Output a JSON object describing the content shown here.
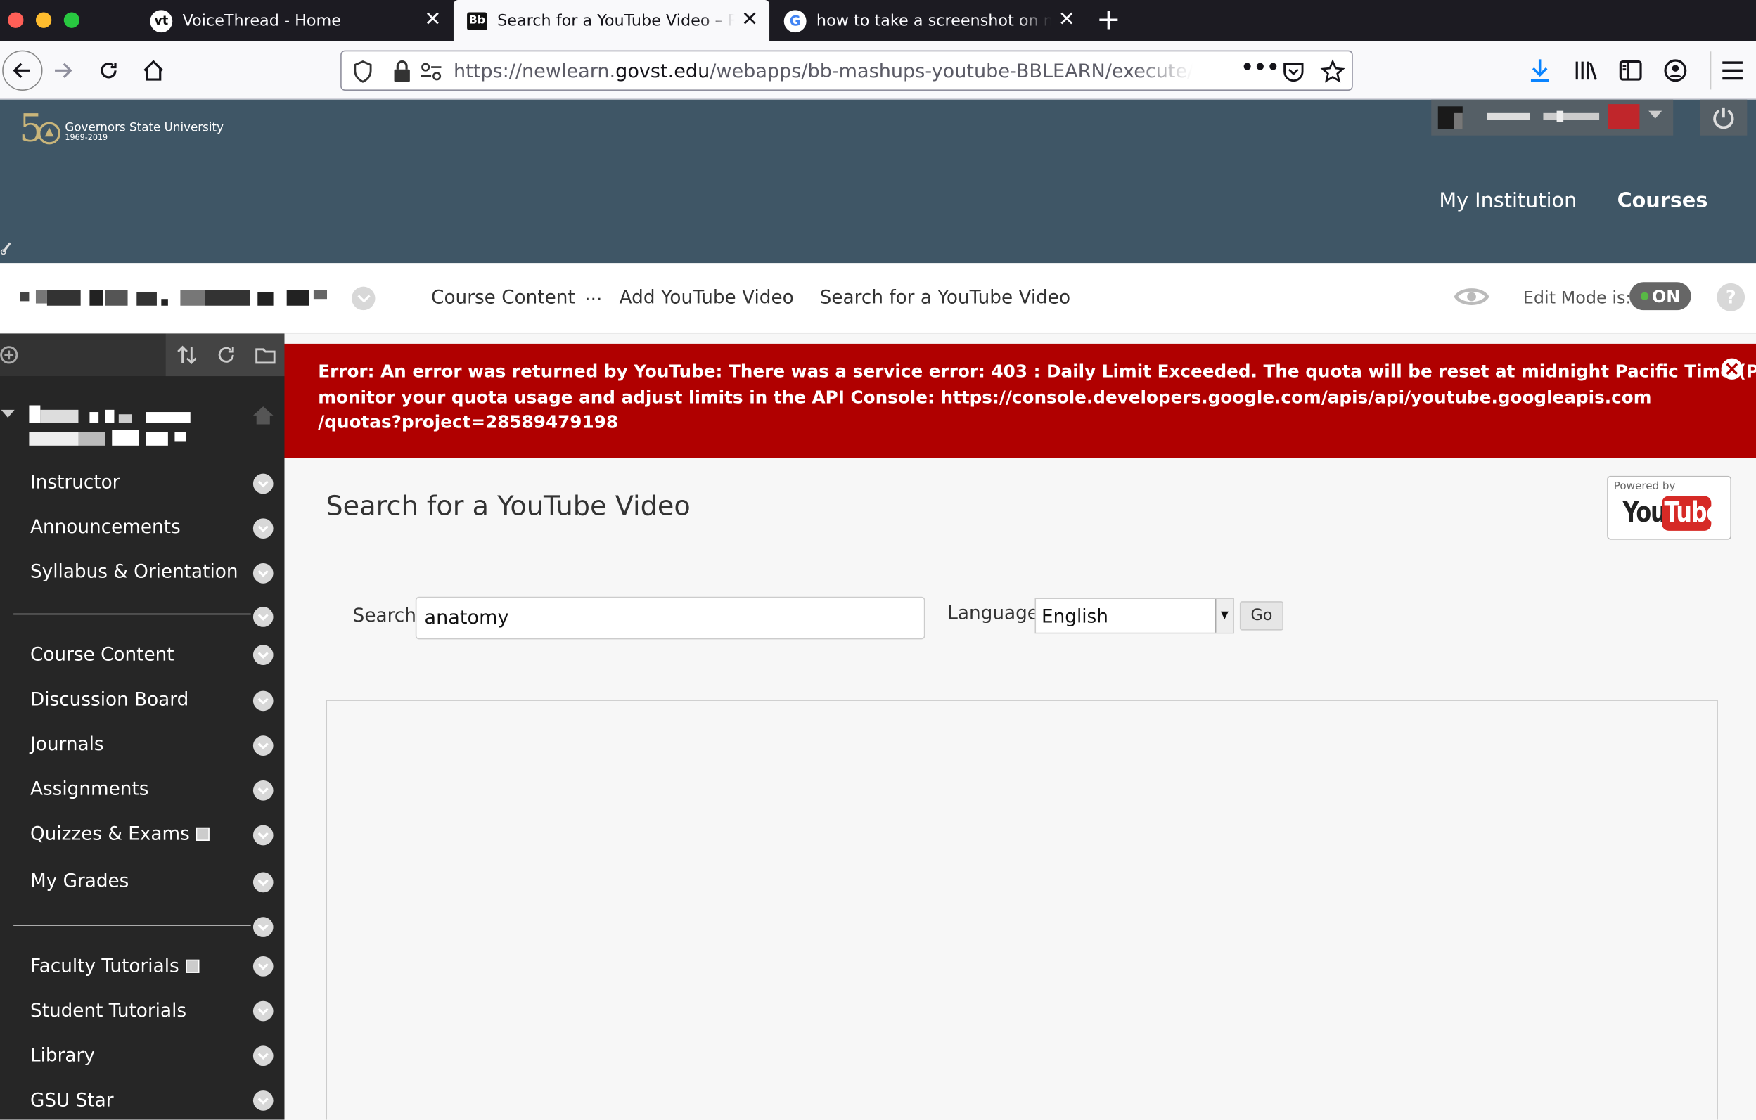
{
  "browser": {
    "tabs": [
      {
        "label": "VoiceThread - Home",
        "favicon": "vt"
      },
      {
        "label": "Search for a YouTube Video – R",
        "favicon": "Bb"
      },
      {
        "label": "how to take a screenshot on ma",
        "favicon": "G"
      }
    ],
    "new_tab": "+",
    "url": {
      "prefix": "https://newlearn.",
      "domain": "govst.edu",
      "path": "/webapps/bb-mashups-youtube-BBLEARN/execute/exe"
    },
    "icons": [
      "back-icon",
      "forward-icon",
      "reload-icon",
      "home-icon",
      "shield-icon",
      "lock-icon",
      "permissions-icon",
      "more-icon",
      "pocket-icon",
      "star-icon",
      "download-icon",
      "library-icon",
      "sidebar-icon",
      "account-icon",
      "menu-icon"
    ]
  },
  "brand": {
    "number": "5",
    "name": "Governors State University",
    "years": "1969-2019"
  },
  "topnav": {
    "my_institution": "My Institution",
    "courses": "Courses"
  },
  "crumbs": {
    "course_content": "Course Content",
    "ellipsis": "...",
    "add_youtube": "Add YouTube Video",
    "current": "Search for a YouTube Video",
    "edit_mode_label": "Edit Mode is:",
    "edit_mode_value": "ON",
    "help": "?"
  },
  "sidebar": {
    "items": [
      {
        "label": "Instructor"
      },
      {
        "label": "Announcements"
      },
      {
        "label": "Syllabus & Orientation"
      },
      {
        "label": "Course Content"
      },
      {
        "label": "Discussion Board"
      },
      {
        "label": "Journals"
      },
      {
        "label": "Assignments"
      },
      {
        "label": "Quizzes & Exams"
      },
      {
        "label": "My Grades"
      },
      {
        "label": "Faculty Tutorials"
      },
      {
        "label": "Student Tutorials"
      },
      {
        "label": "Library"
      },
      {
        "label": "GSU Star"
      }
    ]
  },
  "error": {
    "line1": "Error: An error was returned by YouTube: There was a service error: 403 : Daily Limit Exceeded. The quota will be reset at midnight Pacific Time (PT). You may",
    "line2": "monitor your quota usage and adjust limits in the API Console: https://console.developers.google.com/apis/api/youtube.googleapis.com",
    "line3": "/quotas?project=28589479198"
  },
  "main": {
    "title": "Search for a YouTube Video",
    "youtube_badge": {
      "powered_by": "Powered by",
      "you": "You",
      "tube": "Tube"
    },
    "search_label": "Search",
    "search_value": "anatomy",
    "language_label": "Language",
    "language_value": "English",
    "go": "Go"
  },
  "colors": {
    "header": "#3f5666",
    "error": "#b00000",
    "sidebar": "#262626",
    "edit_on": "#58b845"
  }
}
